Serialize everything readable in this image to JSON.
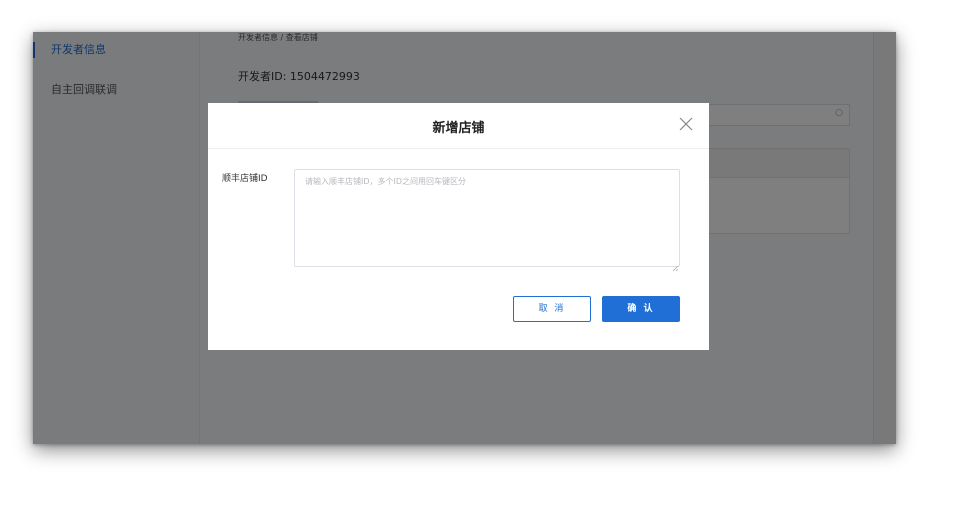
{
  "sidebar": {
    "items": [
      {
        "label": "开发者信息",
        "active": true
      },
      {
        "label": "自主回调联调",
        "active": false
      }
    ]
  },
  "main": {
    "breadcrumb": "开发者信息 / 查看店铺",
    "developer_id": "开发者ID: 1504472993"
  },
  "modal": {
    "title": "新增店铺",
    "field_label": "顺丰店铺ID",
    "textarea_placeholder": "请输入顺丰店铺ID，多个ID之间用回车键区分",
    "textarea_value": "",
    "cancel_label": "取 消",
    "confirm_label": "确 认"
  },
  "colors": {
    "accent": "#1f6fd6",
    "overlay": "rgba(0,0,0,0.5)"
  },
  "icons": [
    "close-icon",
    "search-icon",
    "resize-handle-icon"
  ]
}
